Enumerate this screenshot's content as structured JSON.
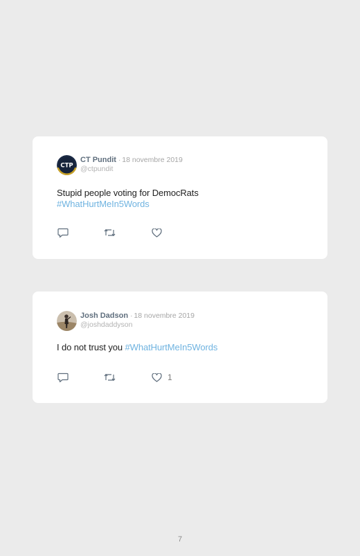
{
  "tweets": [
    {
      "author_name": "CT Pundit",
      "separator": "·",
      "date": "18 novembre 2019",
      "handle": "@ctpundit",
      "avatar_label": "CTP",
      "text_plain": "Stupid people voting for DemocRats ",
      "hashtag": "#WhatHurtMeIn5Words",
      "like_count": ""
    },
    {
      "author_name": "Josh Dadson",
      "separator": "·",
      "date": "18 novembre 2019",
      "handle": "@joshdaddyson",
      "text_plain": "I do not trust you ",
      "hashtag": "#WhatHurtMeIn5Words",
      "like_count": "1"
    }
  ],
  "icons": {
    "reply": "reply-icon",
    "retweet": "retweet-icon",
    "like": "heart-icon"
  },
  "colors": {
    "background": "#ebebeb",
    "card": "#ffffff",
    "hashtag": "#6fb3e0",
    "author": "#5f6e7d",
    "muted": "#a6a6a6"
  },
  "page_number": "7"
}
